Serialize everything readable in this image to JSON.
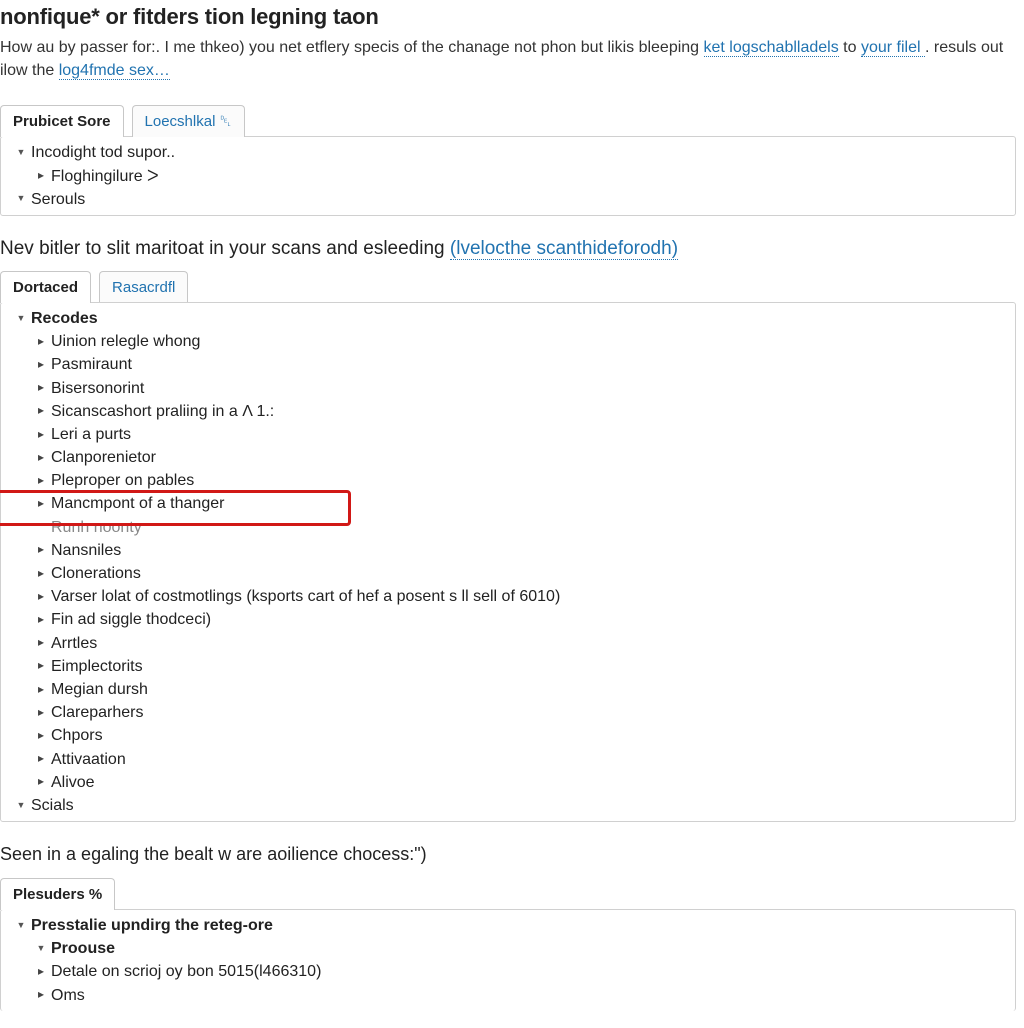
{
  "title": "nonfique* or fitders tion legning taon",
  "intro": {
    "part1": "How au by passer for:. I me thkeo) you net etflery specis of the chanage not phon but likis bleeping ",
    "link1": "ket logschablladels",
    "part2": " to ",
    "link2": "your filel ",
    "part3": ". resuls out ilow the ",
    "link3": "log4fmde sex…"
  },
  "panel1": {
    "tabs": [
      {
        "label": "Prubicet Sore",
        "active": true
      },
      {
        "label": "Loecshlkal ␡",
        "active": false
      }
    ],
    "items": [
      {
        "indent": 0,
        "arrow": "down",
        "label": "Incodight tod supor.."
      },
      {
        "indent": 1,
        "arrow": "right",
        "label": "Floghingilure ᐳ"
      },
      {
        "indent": 0,
        "arrow": "down",
        "label": "Serouls"
      }
    ]
  },
  "section2": {
    "heading_prefix": "Nev bitler to slit maritoat in your scans and esleeding ",
    "heading_link": "(lvelocthe scanthideforodh)"
  },
  "panel2": {
    "tabs": [
      {
        "label": "Dortaced",
        "active": true
      },
      {
        "label": "Rasacrdfl",
        "active": false
      }
    ],
    "root": {
      "label": "Recodes"
    },
    "items": [
      {
        "label": "Uinion relegle whong"
      },
      {
        "label": "Pasmiraunt"
      },
      {
        "label": "Bisersonorint"
      },
      {
        "label": "Sicanscashort praliing in a Λ 1.:"
      },
      {
        "label": "Leri a purts"
      },
      {
        "label": "Clanporenietor"
      },
      {
        "label": "Pleproper on pables"
      },
      {
        "label": "Mancmpont of a thanger",
        "highlight": true
      },
      {
        "label": "Runh noonty",
        "noarrow": true,
        "fade": true
      },
      {
        "label": "Nansniles"
      },
      {
        "label": "Clonerations"
      },
      {
        "label": "Varser lolat of costmotlings (ksports cart of hef a posent s ll sell of 6010)"
      },
      {
        "label": "Fin ad siggle thodceci)"
      },
      {
        "label": "Arrtles"
      },
      {
        "label": "Eimplectorits"
      },
      {
        "label": "Megian dursh"
      },
      {
        "label": "Clareparhers"
      },
      {
        "label": "Chpors"
      },
      {
        "label": "Attivaation"
      },
      {
        "label": "Alivoe"
      }
    ],
    "footer": {
      "label": "Scials"
    }
  },
  "section3": {
    "heading": "Seen in a egaling the bealt w are aoilience chocess:\")"
  },
  "panel3": {
    "tabs": [
      {
        "label": "Plesuders %",
        "active": true
      }
    ],
    "items": [
      {
        "indent": 0,
        "arrow": "down",
        "bold": true,
        "label": "Presstalie upndirg the reteg-ore"
      },
      {
        "indent": 1,
        "arrow": "down",
        "bold": true,
        "label": "Proouse"
      },
      {
        "indent": 1,
        "arrow": "right",
        "label": "Detale on scrioj oy bon 5015(l466310)"
      },
      {
        "indent": 1,
        "arrow": "right",
        "label": "Oms"
      }
    ]
  }
}
